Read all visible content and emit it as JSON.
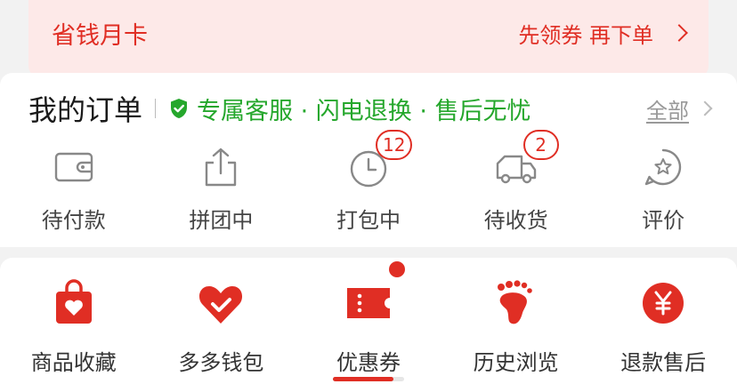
{
  "colors": {
    "accent": "#e02e24",
    "green": "#25a72c",
    "promo_bg": "#fde9e8"
  },
  "promo": {
    "title": "省钱月卡",
    "action": "先领券 再下单"
  },
  "orders": {
    "title": "我的订单",
    "service_text": "专属客服 · 闪电退换 · 售后无忧",
    "all_label": "全部",
    "items": [
      {
        "label": "待付款",
        "icon": "wallet-icon"
      },
      {
        "label": "拼团中",
        "icon": "share-icon"
      },
      {
        "label": "打包中",
        "icon": "clock-icon",
        "badge": "12"
      },
      {
        "label": "待收货",
        "icon": "truck-icon",
        "badge": "2"
      },
      {
        "label": "评价",
        "icon": "star-bubble-icon"
      }
    ]
  },
  "tools": {
    "items": [
      {
        "label": "商品收藏",
        "icon": "heart-bag-icon"
      },
      {
        "label": "多多钱包",
        "icon": "heart-wallet-icon"
      },
      {
        "label": "优惠券",
        "icon": "ticket-icon",
        "dot": true
      },
      {
        "label": "历史浏览",
        "icon": "footprint-icon"
      },
      {
        "label": "退款售后",
        "icon": "yen-icon"
      }
    ],
    "scroll_progress": 0.85
  }
}
